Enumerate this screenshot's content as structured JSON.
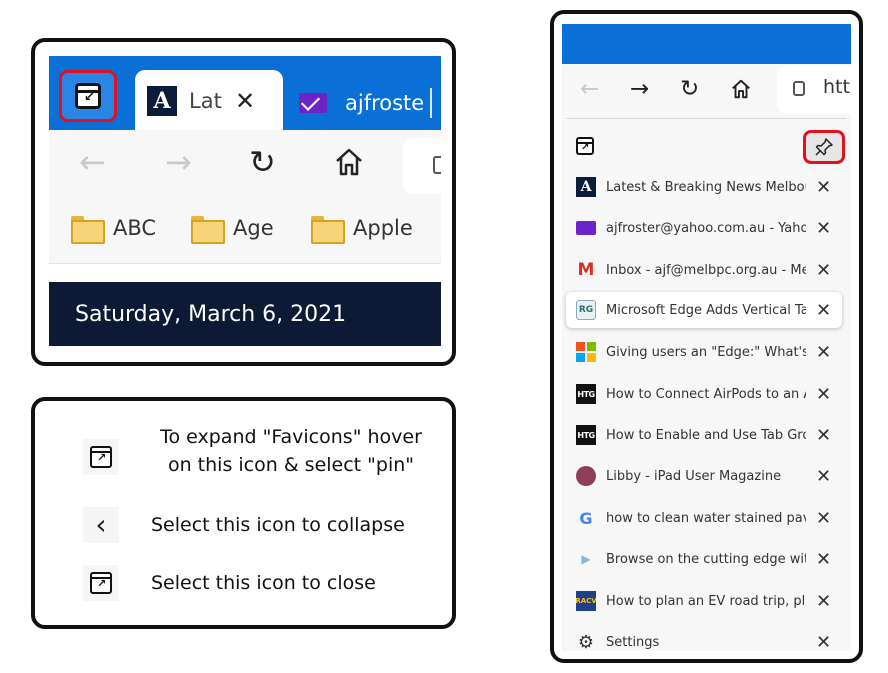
{
  "browser_crop": {
    "active_tab_title": "Lat",
    "second_tab_title": "ajfroste",
    "bookmarks": [
      {
        "label": "ABC"
      },
      {
        "label": "Age"
      },
      {
        "label": "Apple"
      }
    ],
    "date_banner": "Saturday, March 6, 2021"
  },
  "instructions": [
    {
      "icon": "vertical-tabs-icon",
      "text": "To expand \"Favicons\" hover on this icon & select \"pin\""
    },
    {
      "icon": "chevron-left-icon",
      "text": "Select this icon to collapse"
    },
    {
      "icon": "vertical-tabs-icon",
      "text": "Select this icon to close"
    }
  ],
  "sidebar": {
    "address_text": "http",
    "tabs": [
      {
        "favicon": "the-age-icon",
        "title": "Latest & Breaking News Melbourne"
      },
      {
        "favicon": "yahoo-mail-icon",
        "title": "ajfroster@yahoo.com.au - Yahoo"
      },
      {
        "favicon": "gmail-icon",
        "title": "Inbox - ajf@melbpc.org.au - Mel"
      },
      {
        "favicon": "rg-icon",
        "title": "Microsoft Edge Adds Vertical Tab"
      },
      {
        "favicon": "microsoft-icon",
        "title": "Giving users an \"Edge:\" What's ne"
      },
      {
        "favicon": "htg-icon",
        "title": "How to Connect AirPods to an Ap"
      },
      {
        "favicon": "htg-icon",
        "title": "How to Enable and Use Tab Grou"
      },
      {
        "favicon": "libby-icon",
        "title": "Libby - iPad User Magazine"
      },
      {
        "favicon": "google-icon",
        "title": "how to clean water stained paver"
      },
      {
        "favicon": "video-icon",
        "title": "Browse on the cutting edge with"
      },
      {
        "favicon": "racv-icon",
        "title": "How to plan an EV road trip, plus"
      }
    ],
    "settings_label": "Settings",
    "favicon_texts": {
      "the_age": "A",
      "gmail": "M",
      "rg": "RG",
      "htg": "HTG",
      "google": "G",
      "video": "▶",
      "racv": "RACV"
    }
  },
  "colors": {
    "edge_blue": "#0a6fd6",
    "highlight_red": "#e0101e",
    "navy_banner": "#0d1a36"
  }
}
